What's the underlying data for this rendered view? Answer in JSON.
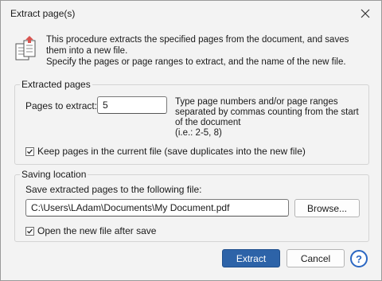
{
  "window": {
    "title": "Extract page(s)"
  },
  "intro": {
    "line1": "This procedure extracts the specified pages from the document, and saves them into a new file.",
    "line2": "Specify the pages or page ranges to extract, and the name of the new file."
  },
  "extracted": {
    "legend": "Extracted pages",
    "pages_label": "Pages to extract:",
    "pages_value": "5",
    "hint": "Type page numbers and/or page ranges separated by commas counting from the start of the document",
    "example": "(i.e.: 2-5, 8)",
    "keep_label": "Keep pages in the current file (save duplicates into the new file)",
    "keep_checked": true
  },
  "saving": {
    "legend": "Saving location",
    "file_label": "Save extracted pages to the following file:",
    "path_value": "C:\\Users\\LAdam\\Documents\\My Document.pdf",
    "browse_label": "Browse...",
    "open_label": "Open the new file after save",
    "open_checked": true
  },
  "buttons": {
    "extract": "Extract",
    "cancel": "Cancel",
    "help": "?"
  },
  "colors": {
    "primary": "#2d63a8",
    "help": "#2a66c2",
    "icon_accent": "#d9534f"
  }
}
